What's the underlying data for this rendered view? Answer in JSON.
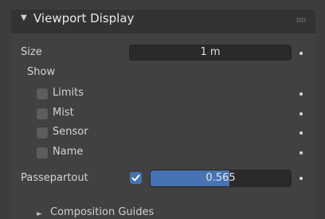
{
  "panel": {
    "title": "Viewport Display",
    "expanded_glyph": "▼",
    "collapsed_glyph": "►"
  },
  "size": {
    "label": "Size",
    "value": "1 m"
  },
  "show": {
    "label": "Show",
    "items": [
      {
        "label": "Limits",
        "checked": false
      },
      {
        "label": "Mist",
        "checked": false
      },
      {
        "label": "Sensor",
        "checked": false
      },
      {
        "label": "Name",
        "checked": false
      }
    ]
  },
  "passepartout": {
    "label": "Passepartout",
    "enabled": true,
    "value": "0.565",
    "fraction": 0.565
  },
  "composition_guides": {
    "label": "Composition Guides",
    "expanded": false
  },
  "colors": {
    "accent": "#4772b3",
    "field_bg": "#2a2a2a",
    "panel_bg": "#414141"
  }
}
